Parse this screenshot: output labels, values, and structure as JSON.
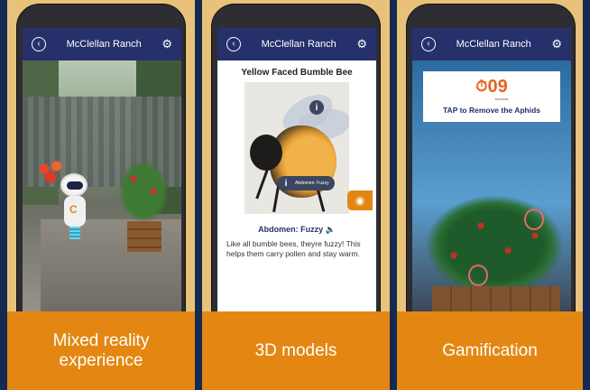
{
  "panels": [
    {
      "app_title": "McClellan Ranch",
      "caption": "Mixed reality experience",
      "scene": "ar-garden"
    },
    {
      "app_title": "McClellan Ranch",
      "caption": "3D models",
      "bee_title": "Yellow Faced Bumble Bee",
      "info_label": "Abdomen: Fuzzy",
      "abdomen_label": "Abdomen: Fuzzy",
      "description": "Like all bumble bees, theyre fuzzy! This helps them carry pollen and stay warm."
    },
    {
      "app_title": "McClellan Ranch",
      "caption": "Gamification",
      "timer_value": "09",
      "timer_unit": "seconds",
      "instruction": "TAP to Remove the Aphids"
    }
  ],
  "icons": {
    "back": "back-arrow-icon",
    "settings": "gear-icon",
    "info": "info-icon",
    "sound": "speaker-icon",
    "camera": "eye-camera-icon",
    "timer": "stopwatch-icon"
  },
  "colors": {
    "background": "#152a52",
    "app_bar": "#26306b",
    "caption_bg": "#e38712",
    "timer_accent": "#e8621e"
  }
}
